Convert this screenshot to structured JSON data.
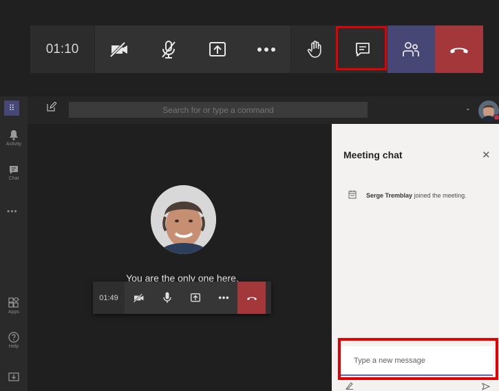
{
  "zoomed_toolbar": {
    "timer": "01:10",
    "buttons": [
      {
        "name": "camera-off"
      },
      {
        "name": "mic-off"
      },
      {
        "name": "share"
      },
      {
        "name": "more"
      },
      {
        "name": "raise-hand"
      },
      {
        "name": "show-conversation"
      },
      {
        "name": "show-participants"
      },
      {
        "name": "hang-up"
      }
    ]
  },
  "header": {
    "search_placeholder": "Search for or type a command"
  },
  "rail": {
    "items": [
      {
        "label": "Activity"
      },
      {
        "label": "Chat"
      },
      {
        "label": "Apps"
      },
      {
        "label": "Help"
      }
    ]
  },
  "stage": {
    "status_text": "You are the only one here."
  },
  "mini_toolbar": {
    "timer": "01:49"
  },
  "chat_panel": {
    "title": "Meeting chat",
    "messages": [
      {
        "author": "Serge Tremblay",
        "text": "joined the meeting."
      }
    ],
    "compose_placeholder": "Type a new message"
  },
  "colors": {
    "hangup": "#a4373a",
    "accent": "#464775",
    "highlight": "#e30000"
  }
}
